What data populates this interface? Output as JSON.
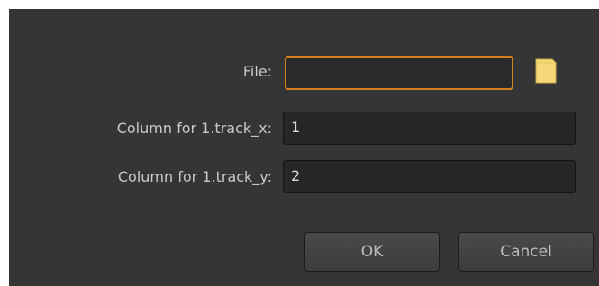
{
  "dialog": {
    "file_label": "File:",
    "file_value": "",
    "folder_icon": "folder-icon",
    "col_x_label": "Column for 1.track_x:",
    "col_x_value": "1",
    "col_y_label": "Column for 1.track_y:",
    "col_y_value": "2",
    "ok_label": "OK",
    "cancel_label": "Cancel"
  },
  "colors": {
    "background": "#353535",
    "focus_accent": "#d67f1c",
    "folder_icon": "#f5d878"
  }
}
